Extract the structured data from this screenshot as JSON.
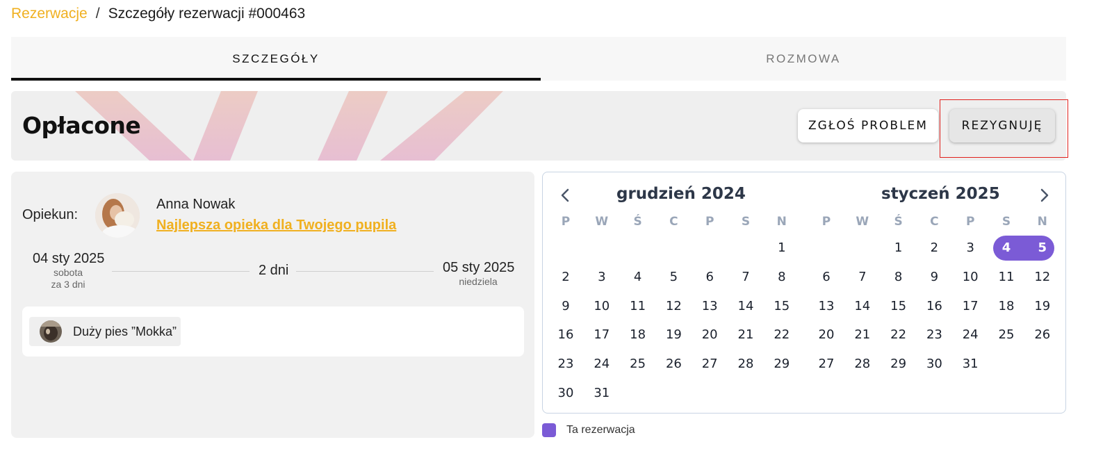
{
  "breadcrumb": {
    "root": "Rezerwacje",
    "separator": "/",
    "current": "Szczegóły rezerwacji #000463"
  },
  "tabs": [
    {
      "label": "SZCZEGÓŁY",
      "active": true
    },
    {
      "label": "ROZMOWA",
      "active": false
    }
  ],
  "status": {
    "title": "Opłacone"
  },
  "actions": {
    "report": "ZGŁOŚ PROBLEM",
    "cancel": "REZYGNUJĘ"
  },
  "caretaker": {
    "label": "Opiekun:",
    "name": "Anna Nowak",
    "headline": "Najlepsza opieka dla Twojego pupila"
  },
  "stay": {
    "start": {
      "date": "04 sty 2025",
      "weekday": "sobota",
      "relative": "za 3 dni"
    },
    "duration": "2 dni",
    "end": {
      "date": "05 sty 2025",
      "weekday": "niedziela"
    }
  },
  "pets": [
    {
      "name": "Duży pies ”Mokka”"
    }
  ],
  "calendar": {
    "weekdays": [
      "P",
      "W",
      "Ś",
      "C",
      "P",
      "S",
      "N"
    ],
    "months": [
      {
        "title": "grudzień 2024",
        "offset": 6,
        "days": 31,
        "selected": []
      },
      {
        "title": "styczeń 2025",
        "offset": 2,
        "days": 31,
        "selected": [
          4,
          5
        ]
      }
    ],
    "accent": "#7b5bd6"
  },
  "legend": {
    "label": "Ta rezerwacja"
  },
  "colors": {
    "link": "#f0b020",
    "selection": "#7b5bd6",
    "highlight_box": "#e0201c"
  }
}
